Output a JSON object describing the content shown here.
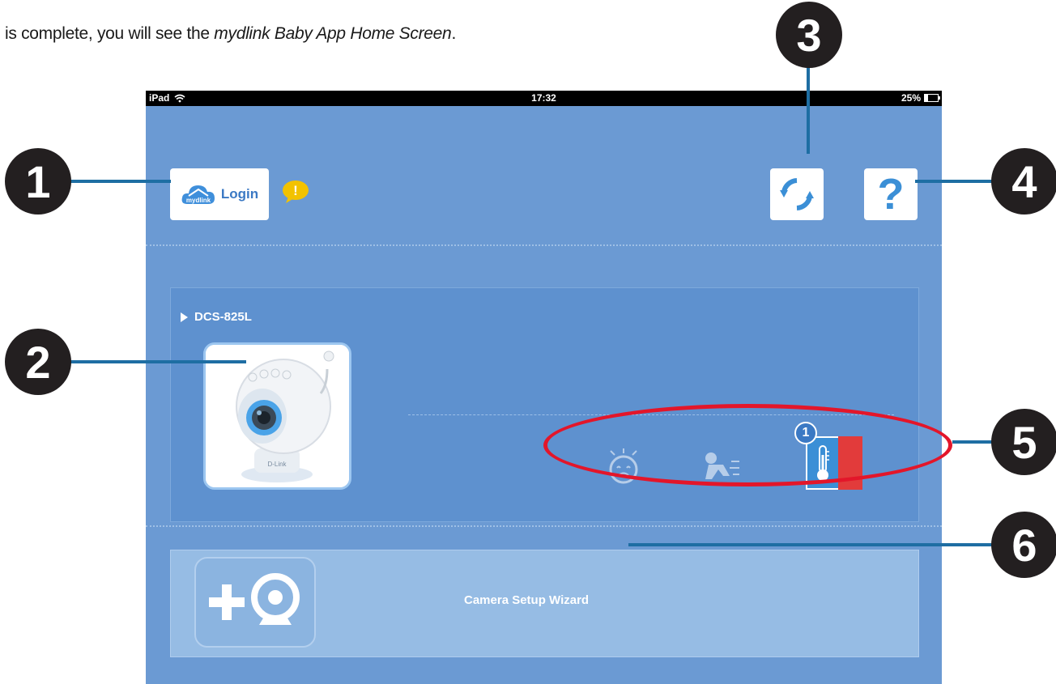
{
  "intro": {
    "prefix": "is complete, you will see the ",
    "emphasis": "mydlink Baby App Home Screen",
    "suffix": "."
  },
  "status_bar": {
    "device": "iPad",
    "time": "17:32",
    "battery": "25%"
  },
  "header": {
    "login_logo_text": "mydlink",
    "login_label": "Login",
    "warning_mark": "!",
    "help_glyph": "?"
  },
  "camera": {
    "name": "DCS-825L",
    "brand_on_device": "D-Link",
    "temperature_badge": "1"
  },
  "wizard": {
    "label": "Camera Setup Wizard"
  },
  "callouts": [
    "1",
    "2",
    "3",
    "4",
    "5",
    "6"
  ],
  "colors": {
    "screen_bg": "#6b9ad3",
    "panel_bg": "#5e91cf",
    "wizard_bg": "#96bce4",
    "callout": "#231f20",
    "leader": "#1e6ea3",
    "highlight": "#e3162a",
    "temp_blue": "#3b8fd6",
    "temp_red": "#e23b3b"
  },
  "icons": [
    "wifi-icon",
    "battery-icon",
    "cloud-icon",
    "warning-icon",
    "refresh-icon",
    "help-icon",
    "chevron-right-icon",
    "crying-baby-icon",
    "crawling-baby-icon",
    "thermometer-icon",
    "add-camera-icon"
  ]
}
